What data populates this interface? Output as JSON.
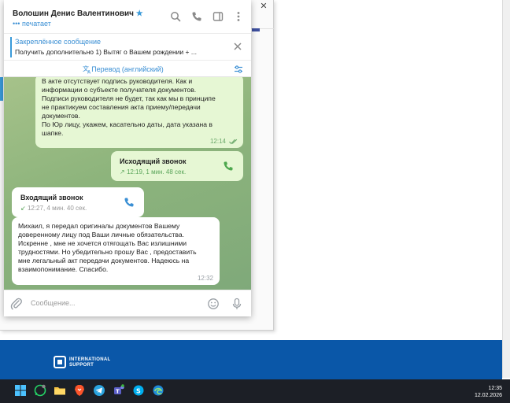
{
  "chat": {
    "contact_name": "Волошин Денис Валентинович",
    "status": "••• печатает",
    "pinned": {
      "title": "Закреплённое сообщение",
      "text": "Получить дополнительно  1) Вытяг о Вашем рождении + ..."
    },
    "translate_label": "Перевод (английский)",
    "messages": [
      {
        "direction": "out",
        "lines": [
          "В акте отсутствует подпись руководителя. Как и",
          "информации о субъекте получателя документов.",
          "Подписи руководителя не будет, так как мы в принципе",
          "не практикуем составления акта приему/передачи",
          "документов.",
          "По Юр лицу, укажем, касательно даты, дата указана в",
          "шапке."
        ],
        "time": "12:14"
      }
    ],
    "calls": [
      {
        "direction": "out",
        "title": "Исходящий звонок",
        "detail": "12:19, 1 мин. 48 сек."
      },
      {
        "direction": "in",
        "title": "Входящий звонок",
        "detail": "12:27, 4 мин. 40 сек."
      }
    ],
    "incoming_message": {
      "lines": [
        "Михаил, я передал оригиналы документов Вашему",
        "доверенному лицу под  Ваши личные обязательства.",
        "Искренне , мне не хочется отягощать Вас излишними",
        "трудностями. Но убедительно прошу Вас , предоставить",
        "мне легальный акт передачи документов. Надеюсь на",
        "взаимопонимание. Спасибо."
      ],
      "time": "12:32"
    },
    "compose_placeholder": "Сообщение..."
  },
  "footer": {
    "logo_line1": "INTERNATIONAL",
    "logo_line2": "SUPPORT"
  },
  "taskbar": {
    "time": "12:35",
    "date": "12.02.2026",
    "apps": [
      "windows-start",
      "whatsapp",
      "file-explorer",
      "brave-browser",
      "telegram",
      "teams",
      "skype",
      "edge"
    ]
  },
  "colors": {
    "accent": "#3a9ad9",
    "outgoing_bubble": "#e6f7d4",
    "footer_blue": "#0a57a8",
    "taskbar": "#1c1f26"
  }
}
